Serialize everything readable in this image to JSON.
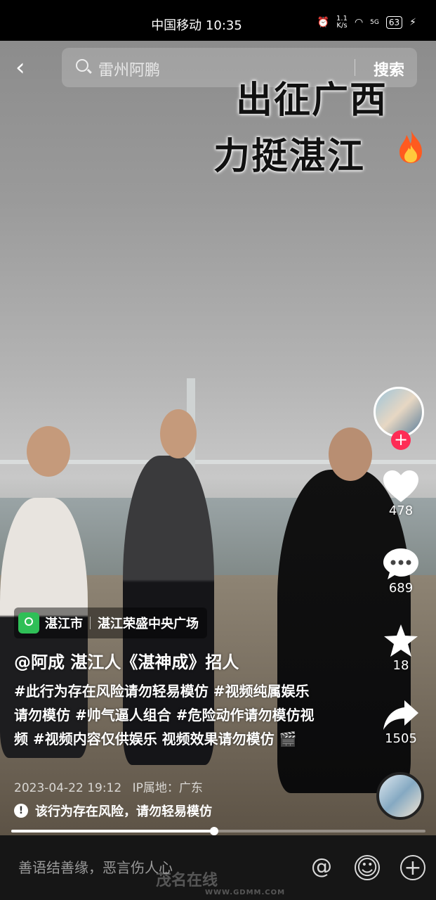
{
  "status_bar": {
    "time_label": "中国移动 10:35",
    "speed_top": "1.1",
    "speed_bottom": "K/s",
    "network": "5G",
    "battery": "63"
  },
  "search": {
    "back_icon": "back-arrow-icon",
    "query": "雷州阿鹏",
    "button_label": "搜索"
  },
  "overlay": {
    "title_line1": "出征广西",
    "title_line2": "力挺湛江",
    "emoji": "fire-icon"
  },
  "actions": {
    "likes": "478",
    "comments": "689",
    "favorites": "18",
    "shares": "1505",
    "follow_label": "+"
  },
  "location": {
    "city": "湛江市",
    "place": "湛江荣盛中央广场"
  },
  "post": {
    "author_line": "@阿成 湛江人《湛神成》招人",
    "caption": "#此行为存在风险请勿轻易模仿 #视频纯属娱乐请勿模仿 #帅气逼人组合 #危险动作请勿模仿视频 #视频内容仅供娱乐 视频效果请勿模仿 🎬",
    "datetime": "2023-04-22 19:12",
    "ip": "IP属地：广东",
    "warning": "该行为存在风险，请勿轻易模仿",
    "progress": 0.49
  },
  "comment_bar": {
    "placeholder": "善语结善缘，恶言伤人心",
    "at_label": "@",
    "emoji_label": "☺",
    "plus_label": "+"
  },
  "watermark": {
    "name": "茂名在线",
    "url": "WWW.GDMM.COM"
  }
}
